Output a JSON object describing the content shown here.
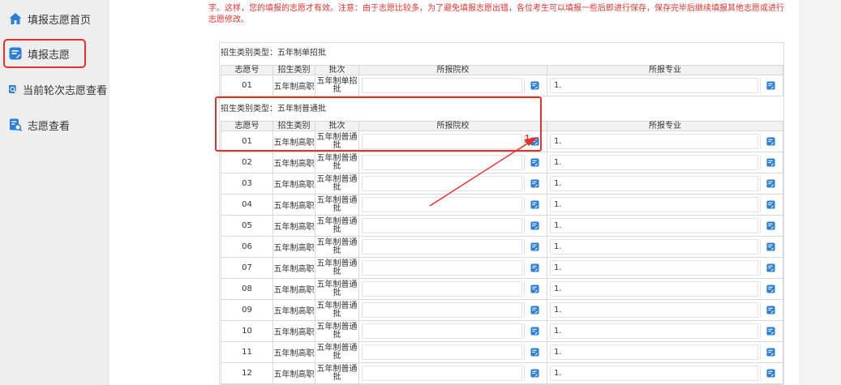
{
  "sidebar": {
    "items": [
      {
        "label": "填报志愿首页",
        "icon": "home-icon",
        "active": false
      },
      {
        "label": "填报志愿",
        "icon": "edit-form-icon",
        "active": true
      },
      {
        "label": "当前轮次志愿查看",
        "icon": "search-doc-icon",
        "active": false
      },
      {
        "label": "志愿查看",
        "icon": "view-doc-icon",
        "active": false
      }
    ]
  },
  "notice": {
    "text": "字。这样，您的填报的志愿才有效。注意：由于志愿比较多，为了避免填报志愿出错，各位考生可以填报一些后即进行保存，保存完毕后继续填报其他志愿或进行志愿修改。"
  },
  "sections": [
    {
      "title": "招生类别类型：五年制单招批",
      "headers": [
        "志愿号",
        "招生类别",
        "批次",
        "所报院校",
        "所报专业"
      ],
      "rows": [
        {
          "no": "01",
          "type": "五年制高职",
          "batch_l1": "五年制单招",
          "batch_l2": "批",
          "school": "",
          "major": "1."
        }
      ]
    },
    {
      "title": "招生类别类型：五年制普通批",
      "headers": [
        "志愿号",
        "招生类别",
        "批次",
        "所报院校",
        "所报专业"
      ],
      "rows": [
        {
          "no": "01",
          "type": "五年制高职",
          "batch_l1": "五年制普通",
          "batch_l2": "批",
          "school": "",
          "major": "1."
        },
        {
          "no": "02",
          "type": "五年制高职",
          "batch_l1": "五年制普通",
          "batch_l2": "批",
          "school": "",
          "major": "1."
        },
        {
          "no": "03",
          "type": "五年制高职",
          "batch_l1": "五年制普通",
          "batch_l2": "批",
          "school": "",
          "major": "1."
        },
        {
          "no": "04",
          "type": "五年制高职",
          "batch_l1": "五年制普通",
          "batch_l2": "批",
          "school": "",
          "major": "1."
        },
        {
          "no": "05",
          "type": "五年制高职",
          "batch_l1": "五年制普通",
          "batch_l2": "批",
          "school": "",
          "major": "1."
        },
        {
          "no": "06",
          "type": "五年制高职",
          "batch_l1": "五年制普通",
          "batch_l2": "批",
          "school": "",
          "major": "1."
        },
        {
          "no": "07",
          "type": "五年制高职",
          "batch_l1": "五年制普通",
          "batch_l2": "批",
          "school": "",
          "major": "1."
        },
        {
          "no": "08",
          "type": "五年制高职",
          "batch_l1": "五年制普通",
          "batch_l2": "批",
          "school": "",
          "major": "1."
        },
        {
          "no": "09",
          "type": "五年制高职",
          "batch_l1": "五年制普通",
          "batch_l2": "批",
          "school": "",
          "major": "1."
        },
        {
          "no": "10",
          "type": "五年制高职",
          "batch_l1": "五年制普通",
          "batch_l2": "批",
          "school": "",
          "major": "1."
        },
        {
          "no": "11",
          "type": "五年制高职",
          "batch_l1": "五年制普通",
          "batch_l2": "批",
          "school": "",
          "major": "1."
        },
        {
          "no": "12",
          "type": "五年制高职",
          "batch_l1": "五年制普通",
          "batch_l2": "批",
          "school": "",
          "major": "1."
        }
      ]
    }
  ],
  "annotation": {
    "marker": "1",
    "color": "#e4312b"
  },
  "colors": {
    "accent": "#e4312b",
    "icon_blue": "#2b7fd6",
    "sidebar_bg": "#eeeeee"
  }
}
